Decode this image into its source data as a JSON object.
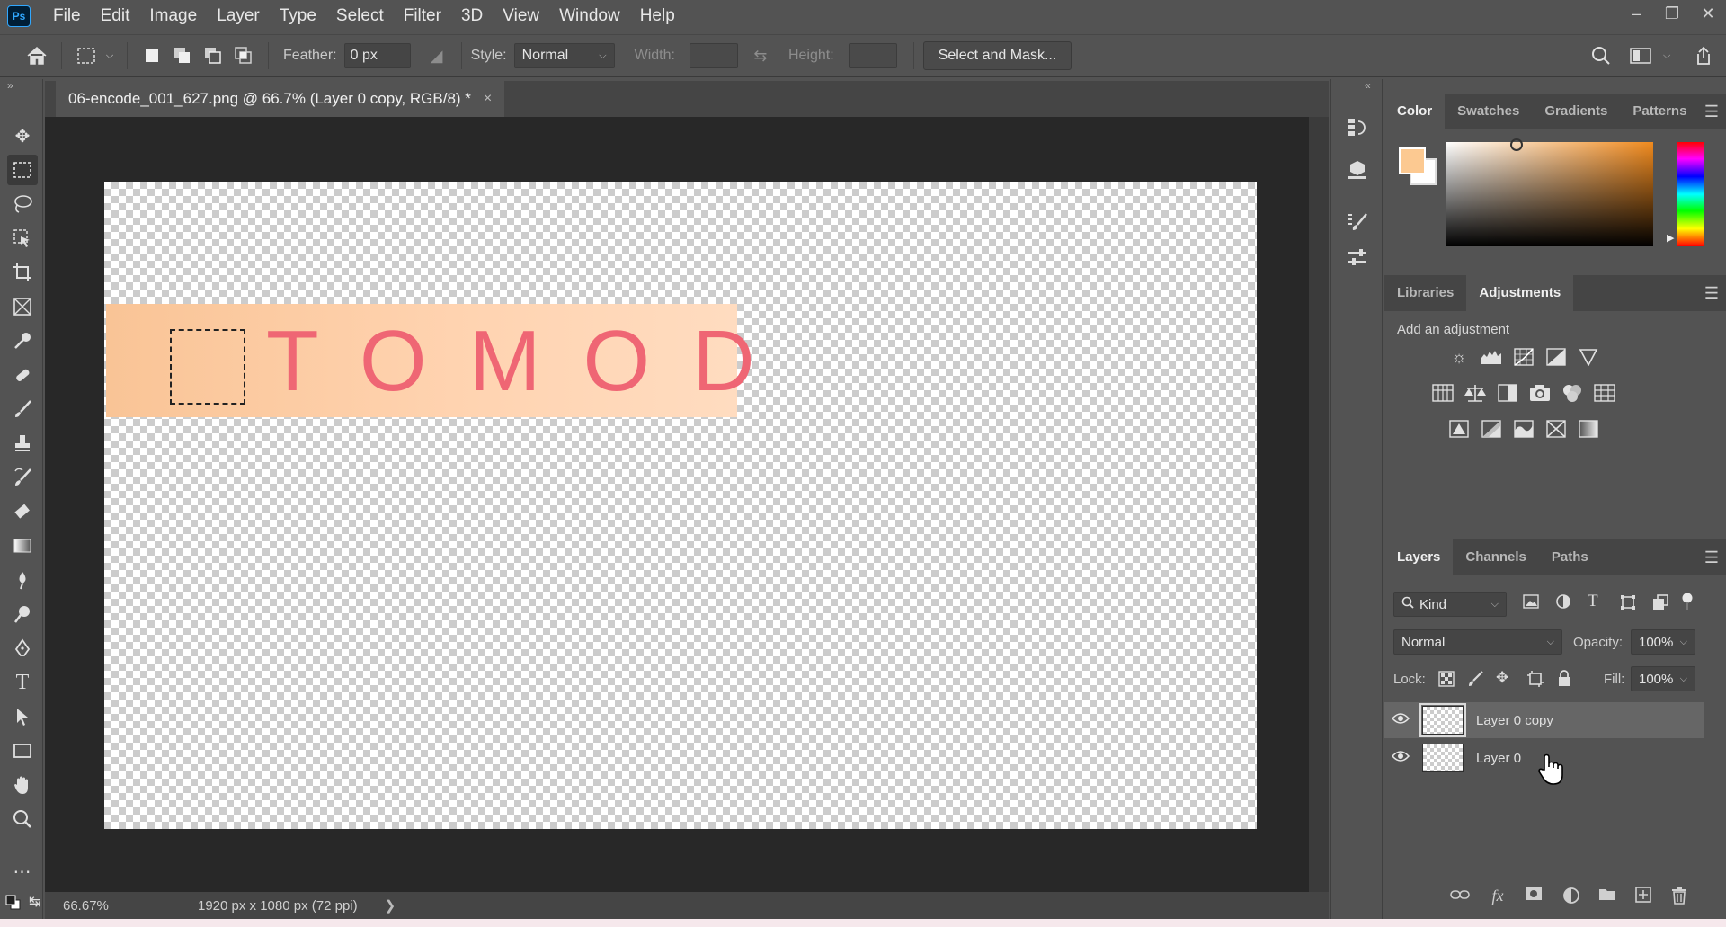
{
  "app": {
    "logo": "Ps"
  },
  "menu": [
    "File",
    "Edit",
    "Image",
    "Layer",
    "Type",
    "Select",
    "Filter",
    "3D",
    "View",
    "Window",
    "Help"
  ],
  "window_controls": {
    "minimize": "–",
    "restore": "❐",
    "close": "✕"
  },
  "options": {
    "feather_label": "Feather:",
    "feather_value": "0 px",
    "style_label": "Style:",
    "style_value": "Normal",
    "width_label": "Width:",
    "height_label": "Height:",
    "select_mask": "Select and Mask..."
  },
  "document": {
    "tab_title": "06-encode_001_627.png @ 66.7% (Layer 0 copy, RGB/8) *",
    "close": "×",
    "canvas_text": "TOMOD"
  },
  "status": {
    "zoom": "66.67%",
    "doc_info": "1920 px x 1080 px (72 ppi)",
    "arrow": "❯"
  },
  "color_panel": {
    "tabs": [
      "Color",
      "Swatches",
      "Gradients",
      "Patterns"
    ],
    "foreground": "#fcc991",
    "background": "#ffffff"
  },
  "adjustments_panel": {
    "tabs": [
      "Libraries",
      "Adjustments"
    ],
    "heading": "Add an adjustment"
  },
  "layers_panel": {
    "tabs": [
      "Layers",
      "Channels",
      "Paths"
    ],
    "filter_kind": "Kind",
    "blend_mode": "Normal",
    "opacity_label": "Opacity:",
    "opacity_value": "100%",
    "lock_label": "Lock:",
    "fill_label": "Fill:",
    "fill_value": "100%",
    "layers": [
      {
        "name": "Layer 0 copy",
        "selected": true
      },
      {
        "name": "Layer 0",
        "selected": false
      }
    ]
  },
  "colors": {
    "accent": "#31a8ff",
    "canvas_bg": "#282828",
    "text_on_canvas": "#ef6674",
    "strip": "#f9c496"
  }
}
